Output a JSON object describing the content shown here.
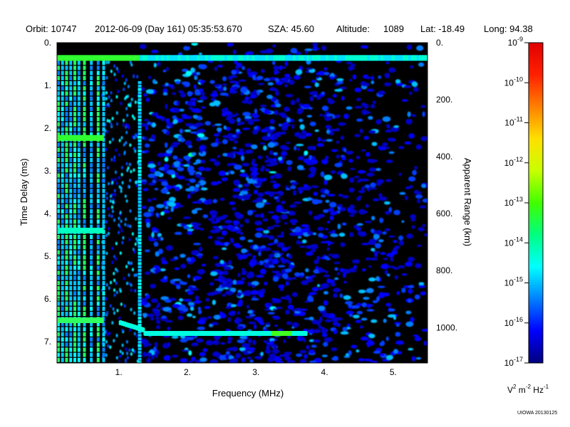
{
  "header": {
    "orbit": "Orbit: 10747",
    "datetime": "2012-06-09 (Day 161) 05:35:53.670",
    "sza": "SZA:  45.60",
    "altitude_label": "Altitude:",
    "altitude_value": "1089",
    "lat": "Lat: -18.49",
    "long": "Long:  94.38"
  },
  "chart_data": {
    "type": "heatmap",
    "title": "",
    "xlabel": "Frequency (MHz)",
    "ylabel": "Time Delay (ms)",
    "y2label": "Apparent Range (km)",
    "xlim": [
      0.1,
      5.5
    ],
    "ylim": [
      0,
      7.5
    ],
    "y_inverted": true,
    "x_ticks": [
      1,
      2,
      3,
      4,
      5
    ],
    "x_tick_labels": [
      "1.",
      "2.",
      "3.",
      "4.",
      "5."
    ],
    "y_ticks": [
      0,
      1,
      2,
      3,
      4,
      5,
      6,
      7
    ],
    "y_tick_labels": [
      "0.",
      "1.",
      "2.",
      "3.",
      "4.",
      "5.",
      "6.",
      "7."
    ],
    "y2_ticks_km": [
      0,
      200,
      400,
      600,
      800,
      1000
    ],
    "y2_tick_labels": [
      "0.",
      "200.",
      "400.",
      "600.",
      "800.",
      "1000."
    ],
    "km_per_ms": 149.9,
    "background_color": "#000000",
    "colorbar": {
      "label_base": "V",
      "label_exp1": "2",
      "label_mid": " m",
      "label_exp2": "-2",
      "label_mid2": " Hz",
      "label_exp3": "-1",
      "scale": "log",
      "min_exponent": -17,
      "max_exponent": -9,
      "tick_exponents": [
        -9,
        -10,
        -11,
        -12,
        -13,
        -14,
        -15,
        -16,
        -17
      ],
      "tick_base": "10",
      "tick_sups": [
        "-9",
        "-10",
        "-11",
        "-12",
        "-13",
        "-14",
        "-15",
        "-16",
        "-17"
      ],
      "colors": [
        "#00007f",
        "#0000ff",
        "#0080ff",
        "#00ffff",
        "#00ff80",
        "#40ff00",
        "#c8ff00",
        "#ffe000",
        "#ff8000",
        "#ff2000",
        "#e00000"
      ]
    },
    "features": [
      {
        "name": "surface echo",
        "delay_ms": 6.8,
        "freq_range_mhz": [
          1.0,
          3.7
        ],
        "level": "1e-15 to 1e-14"
      },
      {
        "name": "ionospheric trace",
        "delay_ms": 0.35,
        "freq_range_mhz": [
          0.1,
          5.5
        ],
        "level": "1e-15 to 1e-14"
      },
      {
        "name": "local plasma harmonics",
        "freq_range_mhz": [
          0.1,
          0.8
        ],
        "level": "1e-14"
      },
      {
        "name": "background noise",
        "freq_range_mhz": [
          1.3,
          5.5
        ],
        "level": "1e-17 to 1e-16"
      }
    ]
  },
  "credit": "UIOWA 20130125"
}
